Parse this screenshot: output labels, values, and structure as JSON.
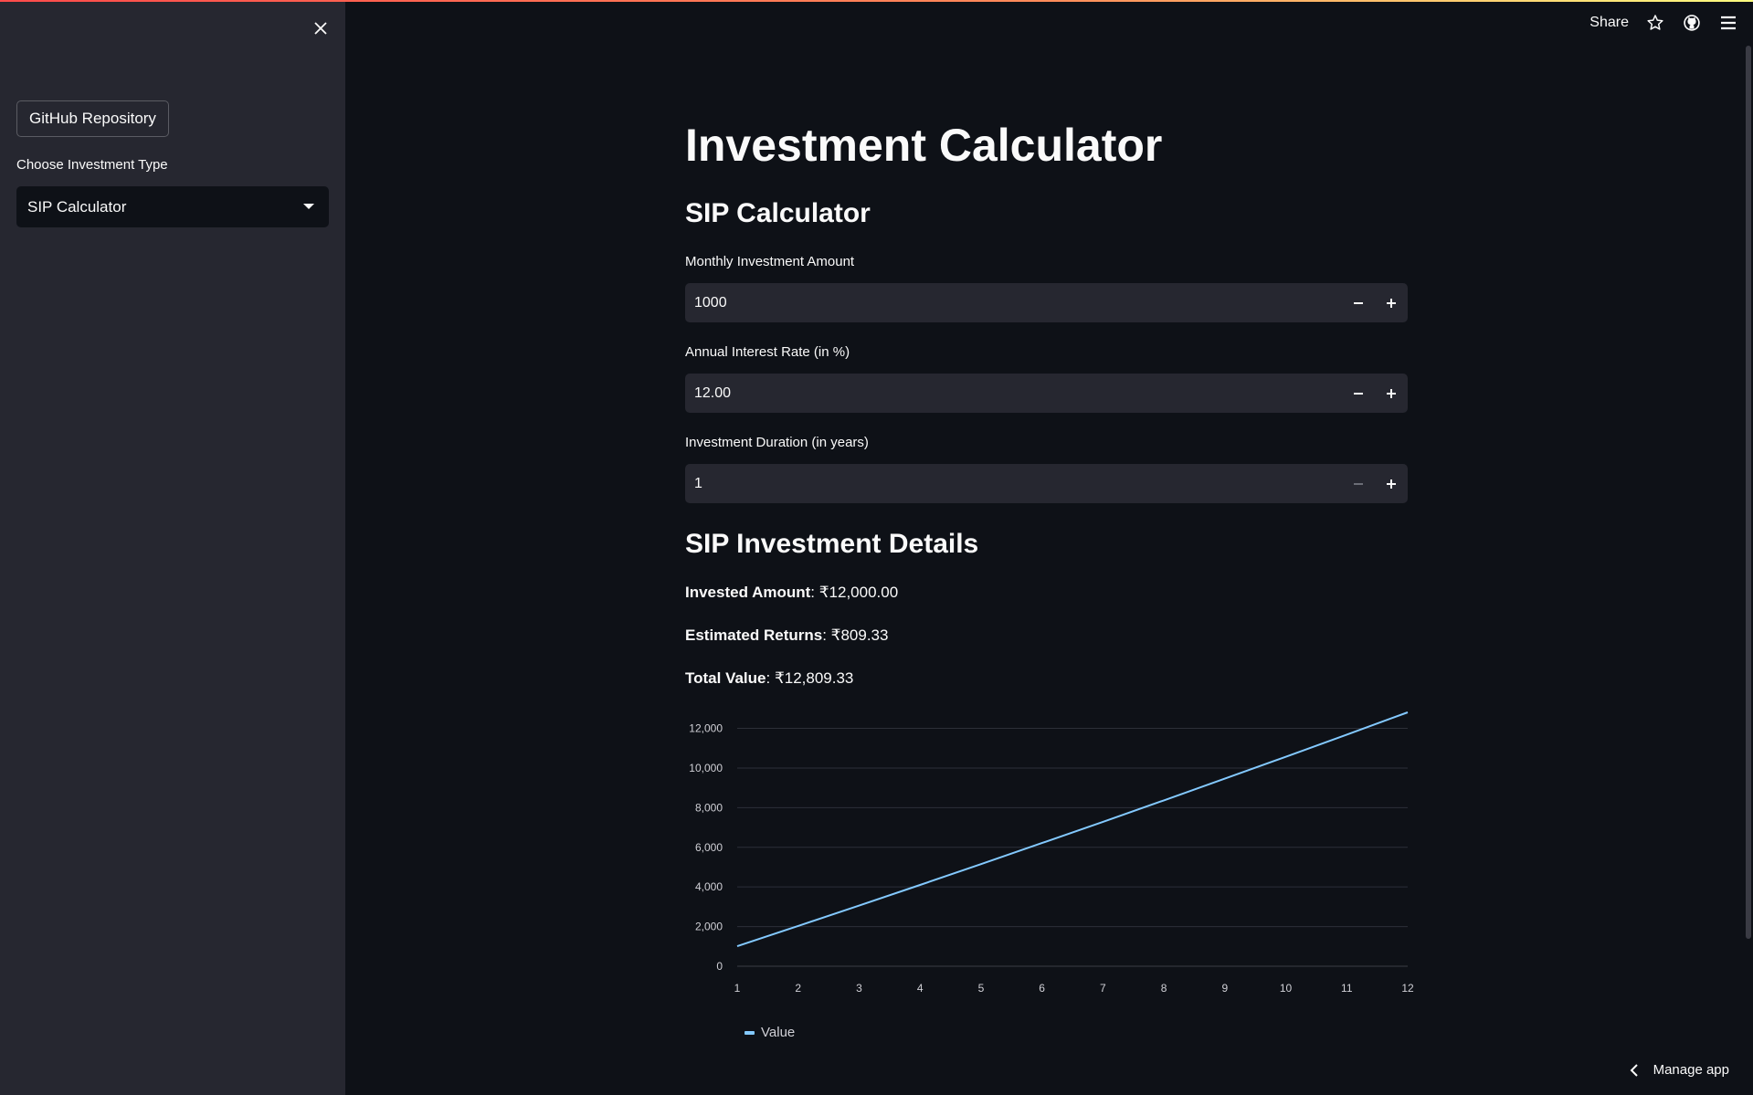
{
  "sidebar": {
    "github_button": "GitHub Repository",
    "select_label": "Choose Investment Type",
    "select_value": "SIP Calculator"
  },
  "header": {
    "share": "Share"
  },
  "main": {
    "title": "Investment Calculator",
    "section_title": "SIP Calculator",
    "fields": [
      {
        "label": "Monthly Investment Amount",
        "value": "1000"
      },
      {
        "label": "Annual Interest Rate (in %)",
        "value": "12.00"
      },
      {
        "label": "Investment Duration (in years)",
        "value": "1"
      }
    ],
    "details_title": "SIP Investment Details",
    "details": [
      {
        "label": "Invested Amount",
        "value": ": ₹12,000.00"
      },
      {
        "label": "Estimated Returns",
        "value": ": ₹809.33"
      },
      {
        "label": "Total Value",
        "value": ": ₹12,809.33"
      }
    ]
  },
  "footer": {
    "manage_app": "Manage app"
  },
  "colors": {
    "accent": "#ff4b4b",
    "line": "#83c9ff",
    "bg": "#0e1117",
    "sidebar": "#262730"
  },
  "chart_data": {
    "type": "line",
    "x": [
      1,
      2,
      3,
      4,
      5,
      6,
      7,
      8,
      9,
      10,
      11,
      12
    ],
    "series": [
      {
        "name": "Value",
        "values": [
          1010,
          2030,
          3060,
          4101,
          5152,
          6214,
          7286,
          8369,
          9462,
          10567,
          11683,
          12809
        ]
      }
    ],
    "xticks": [
      "1",
      "2",
      "3",
      "4",
      "5",
      "6",
      "7",
      "8",
      "9",
      "10",
      "11",
      "12"
    ],
    "yticks": [
      "0",
      "2,000",
      "4,000",
      "6,000",
      "8,000",
      "10,000",
      "12,000"
    ],
    "ylim": [
      0,
      12809
    ],
    "grid": true,
    "legend": "bottom-left"
  }
}
